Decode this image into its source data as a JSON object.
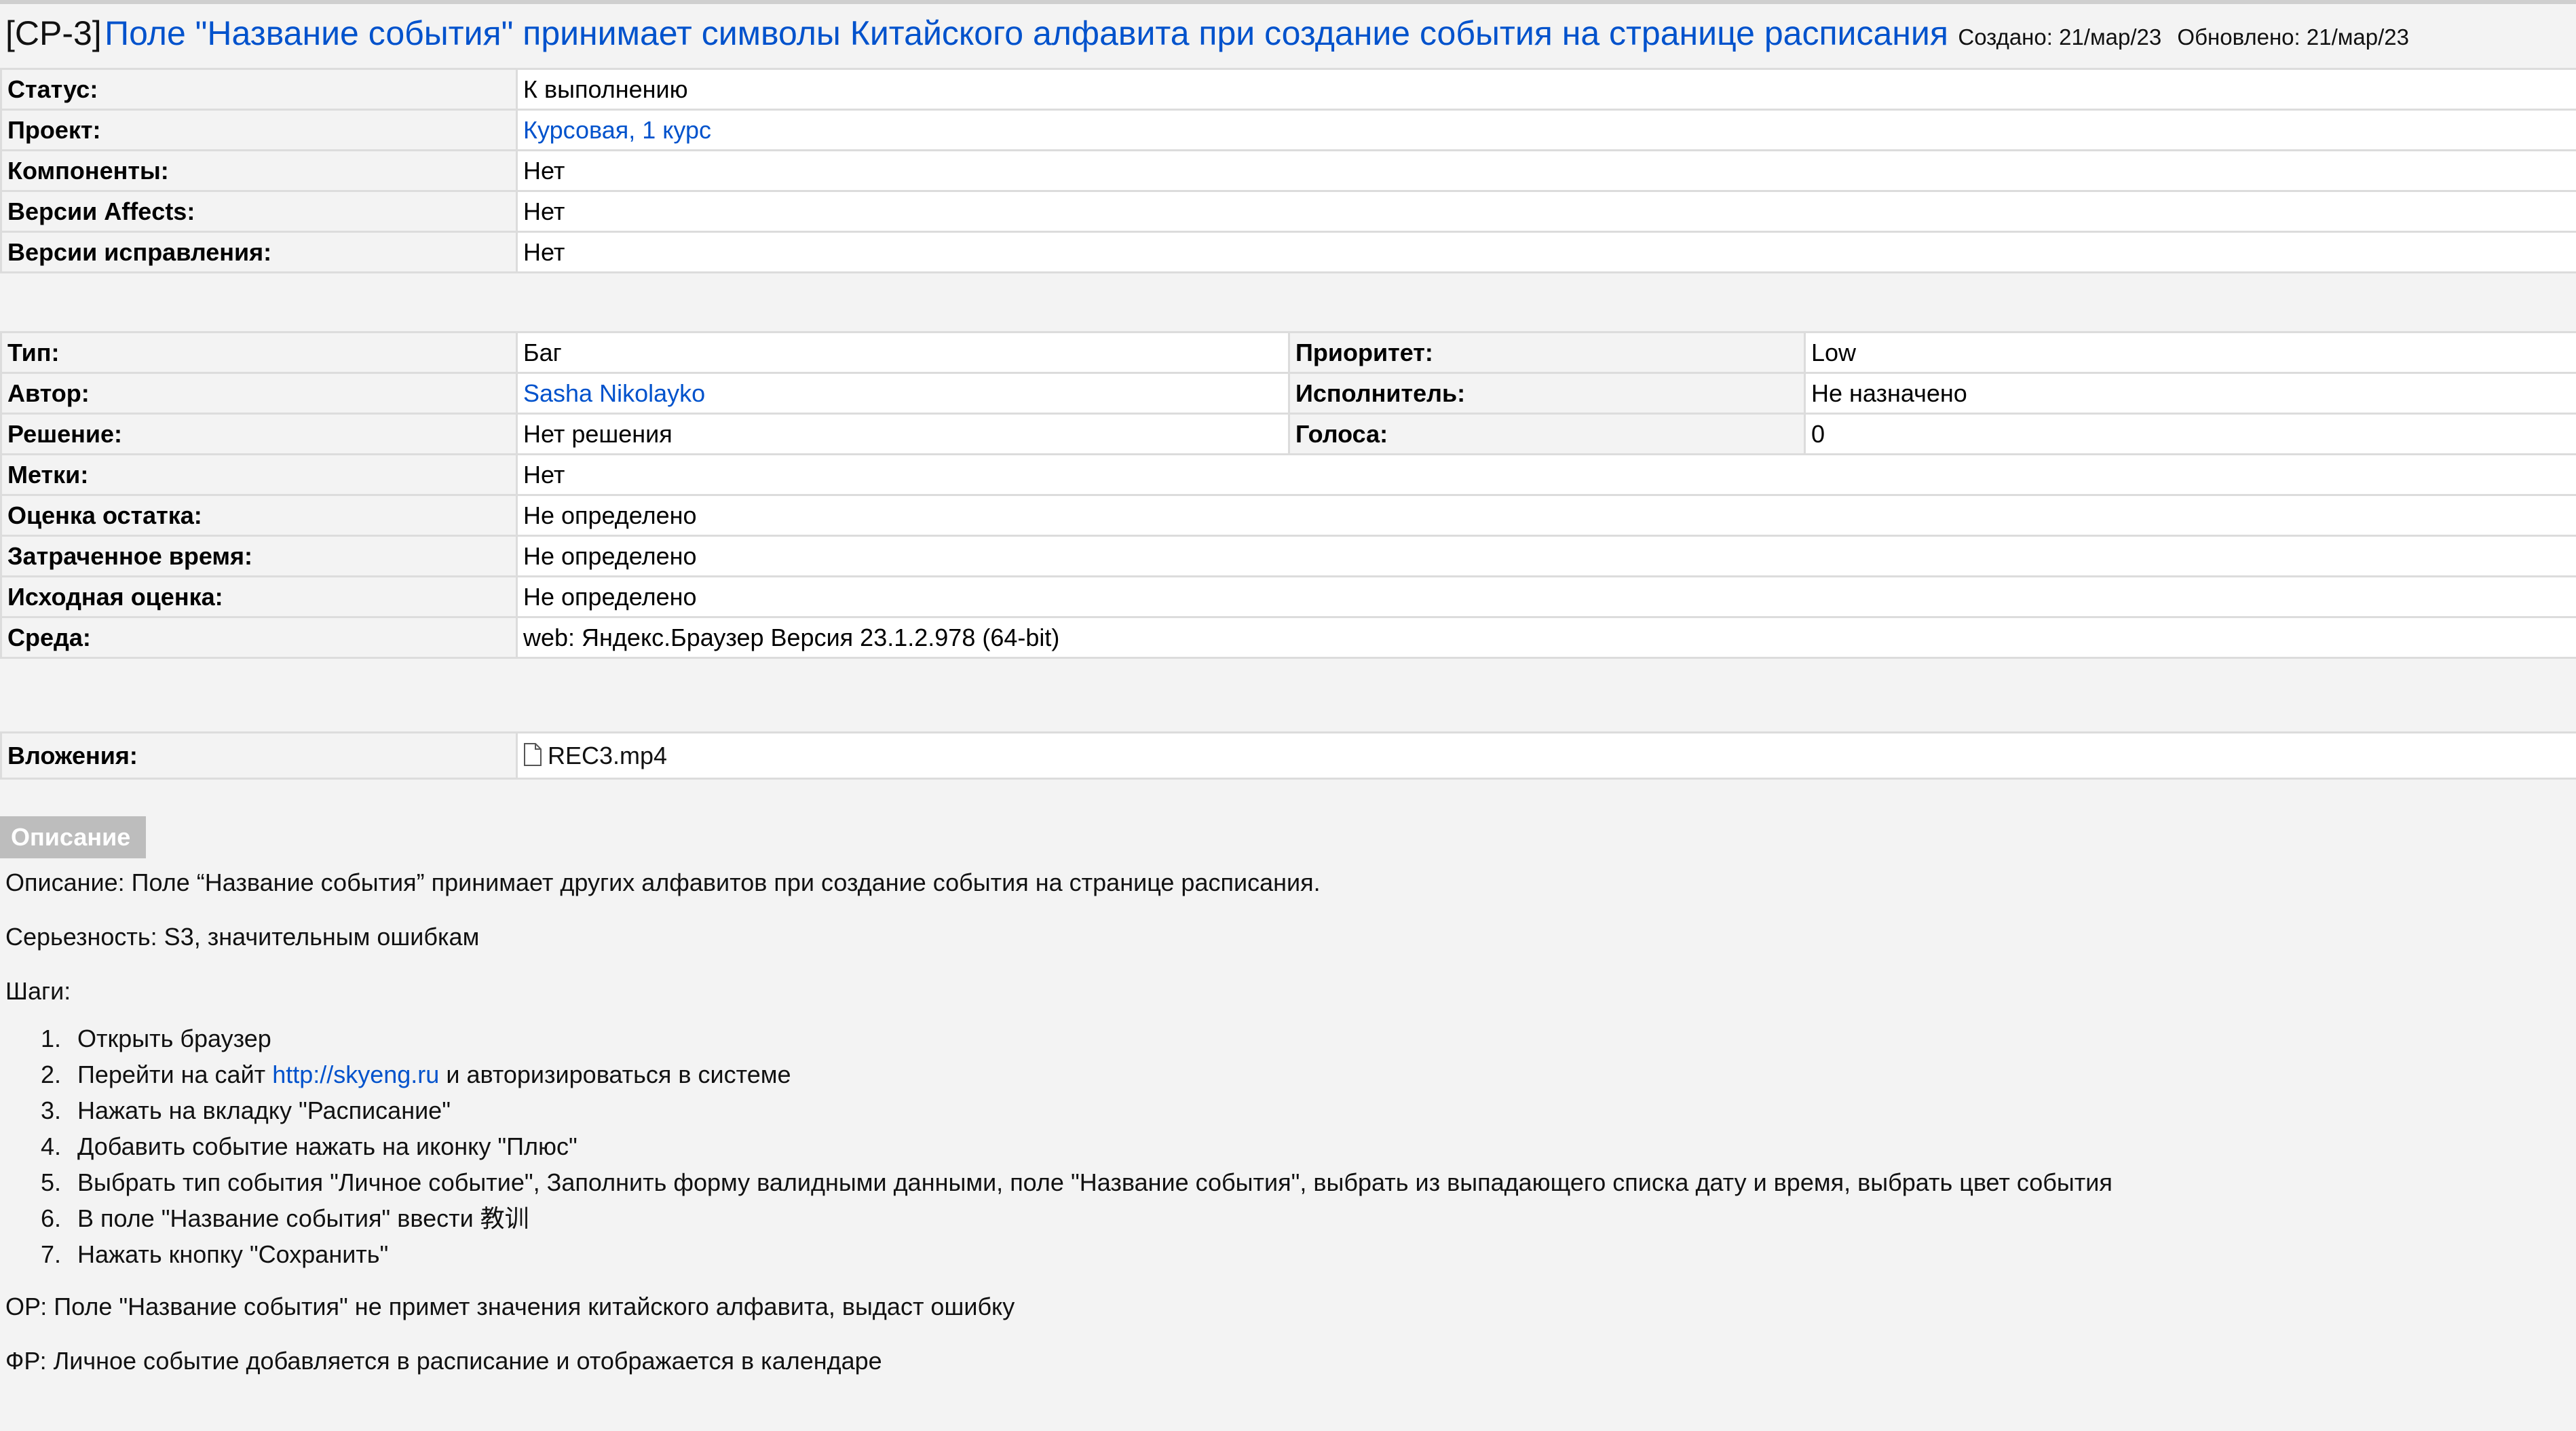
{
  "issue": {
    "key": "[CP-3]",
    "title": "Поле \"Название события\" принимает символы Китайского алфавита при создание события на странице расписания",
    "created": "Создано: 21/мар/23",
    "updated": "Обновлено: 21/мар/23"
  },
  "fields_top": [
    {
      "label": "Статус:",
      "value": "К выполнению",
      "link": false
    },
    {
      "label": "Проект:",
      "value": "Курсовая, 1 курс",
      "link": true
    },
    {
      "label": "Компоненты:",
      "value": "Нет",
      "link": false
    },
    {
      "label": "Версии Affects:",
      "value": "Нет",
      "link": false
    },
    {
      "label": "Версии исправления:",
      "value": "Нет",
      "link": false
    }
  ],
  "fields_mid": {
    "type_label": "Тип:",
    "type_value": "Баг",
    "priority_label": "Приоритет:",
    "priority_value": "Low",
    "author_label": "Автор:",
    "author_value": "Sasha Nikolayko",
    "assignee_label": "Исполнитель:",
    "assignee_value": "Не назначено",
    "resolution_label": "Решение:",
    "resolution_value": "Нет решения",
    "votes_label": "Голоса:",
    "votes_value": "0",
    "labels_label": "Метки:",
    "labels_value": "Нет",
    "remaining_label": "Оценка остатка:",
    "remaining_value": "Не определено",
    "spent_label": "Затраченное время:",
    "spent_value": "Не определено",
    "original_label": "Исходная оценка:",
    "original_value": "Не определено",
    "env_label": "Среда:",
    "env_value": "web: Яндекс.Браузер Версия 23.1.2.978 (64-bit)"
  },
  "attachments": {
    "label": "Вложения:",
    "file_icon": "file-icon",
    "file": "REC3.mp4"
  },
  "description": {
    "tab": "Описание",
    "summary": "Описание: Поле “Название события” принимает других алфавитов при создание события на странице расписания.",
    "severity": "Серьезность: S3, значительным ошибкам",
    "steps_label": "Шаги:",
    "steps": [
      {
        "num": "1.",
        "text": "Открыть браузер"
      },
      {
        "num": "2.",
        "pre": "Перейти на сайт ",
        "link": "http://skyeng.ru",
        "post": " и авторизироваться в системе"
      },
      {
        "num": "3.",
        "text": "Нажать на вкладку \"Расписание\""
      },
      {
        "num": "4.",
        "text": "Добавить событие нажать на иконку \"Плюс\""
      },
      {
        "num": "5.",
        "text": "Выбрать тип события \"Личное событие\", Заполнить форму валидными данными, поле \"Название события\", выбрать из выпадающего списка дату и время, выбрать цвет события"
      },
      {
        "num": "6.",
        "text": "В поле \"Название события\" ввести 教训"
      },
      {
        "num": "7.",
        "text": "Нажать кнопку \"Сохранить\""
      }
    ],
    "expected": "ОР: Поле \"Название события\" не примет значения китайского алфавита, выдаст ошибку",
    "actual": "ФР: Личное событие добавляется в расписание и отображается в календаре"
  },
  "colors": {
    "link": "#0052cc",
    "label_bg": "#f3f3f3",
    "value_bg": "#ffffff",
    "border": "#dcdcdc",
    "tab_bg": "#bdbdbd"
  }
}
